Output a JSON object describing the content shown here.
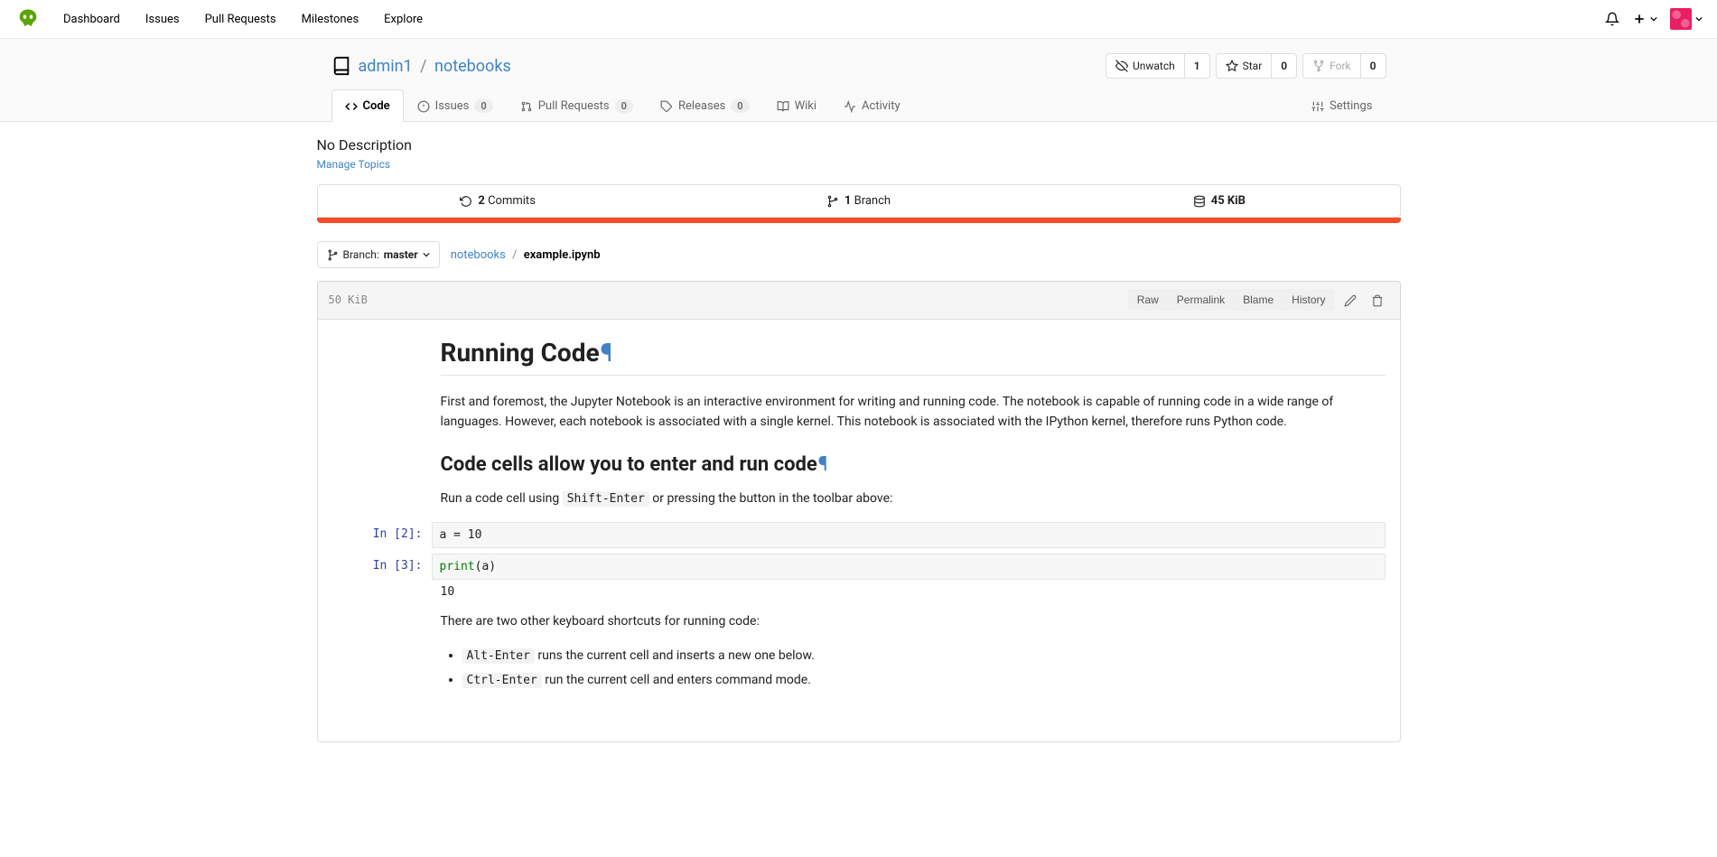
{
  "nav": {
    "dashboard": "Dashboard",
    "issues": "Issues",
    "pull_requests": "Pull Requests",
    "milestones": "Milestones",
    "explore": "Explore"
  },
  "repo": {
    "owner": "admin1",
    "name": "notebooks",
    "watch_label": "Unwatch",
    "watch_count": "1",
    "star_label": "Star",
    "star_count": "0",
    "fork_label": "Fork",
    "fork_count": "0"
  },
  "tabs": {
    "code": "Code",
    "issues": "Issues",
    "issues_count": "0",
    "pulls": "Pull Requests",
    "pulls_count": "0",
    "releases": "Releases",
    "releases_count": "0",
    "wiki": "Wiki",
    "activity": "Activity",
    "settings": "Settings"
  },
  "body": {
    "description": "No Description",
    "manage_topics": "Manage Topics",
    "commits_count": "2",
    "commits_label": " Commits",
    "branch_count": "1",
    "branch_label": " Branch",
    "size": "45 KiB"
  },
  "branch": {
    "label": "Branch: ",
    "name": "master"
  },
  "crumb": {
    "root": "notebooks",
    "file": "example.ipynb"
  },
  "file": {
    "size": "50 KiB",
    "raw": "Raw",
    "permalink": "Permalink",
    "blame": "Blame",
    "history": "History"
  },
  "nb": {
    "h1": "Running Code",
    "p1": "First and foremost, the Jupyter Notebook is an interactive environment for writing and running code. The notebook is capable of running code in a wide range of languages. However, each notebook is associated with a single kernel. This notebook is associated with the IPython kernel, therefore runs Python code.",
    "h2": "Code cells allow you to enter and run code",
    "p2a": "Run a code cell using ",
    "p2_code": "Shift-Enter",
    "p2b": " or pressing the button in the toolbar above:",
    "prompt2": "In [2]:",
    "code2": "a = 10",
    "prompt3": "In [3]:",
    "code3_kw": "print",
    "code3_rest": "(a)",
    "out3": "10",
    "p3": "There are two other keyboard shortcuts for running code:",
    "li1_code": "Alt-Enter",
    "li1_rest": " runs the current cell and inserts a new one below.",
    "li2_code": "Ctrl-Enter",
    "li2_rest": " run the current cell and enters command mode."
  }
}
